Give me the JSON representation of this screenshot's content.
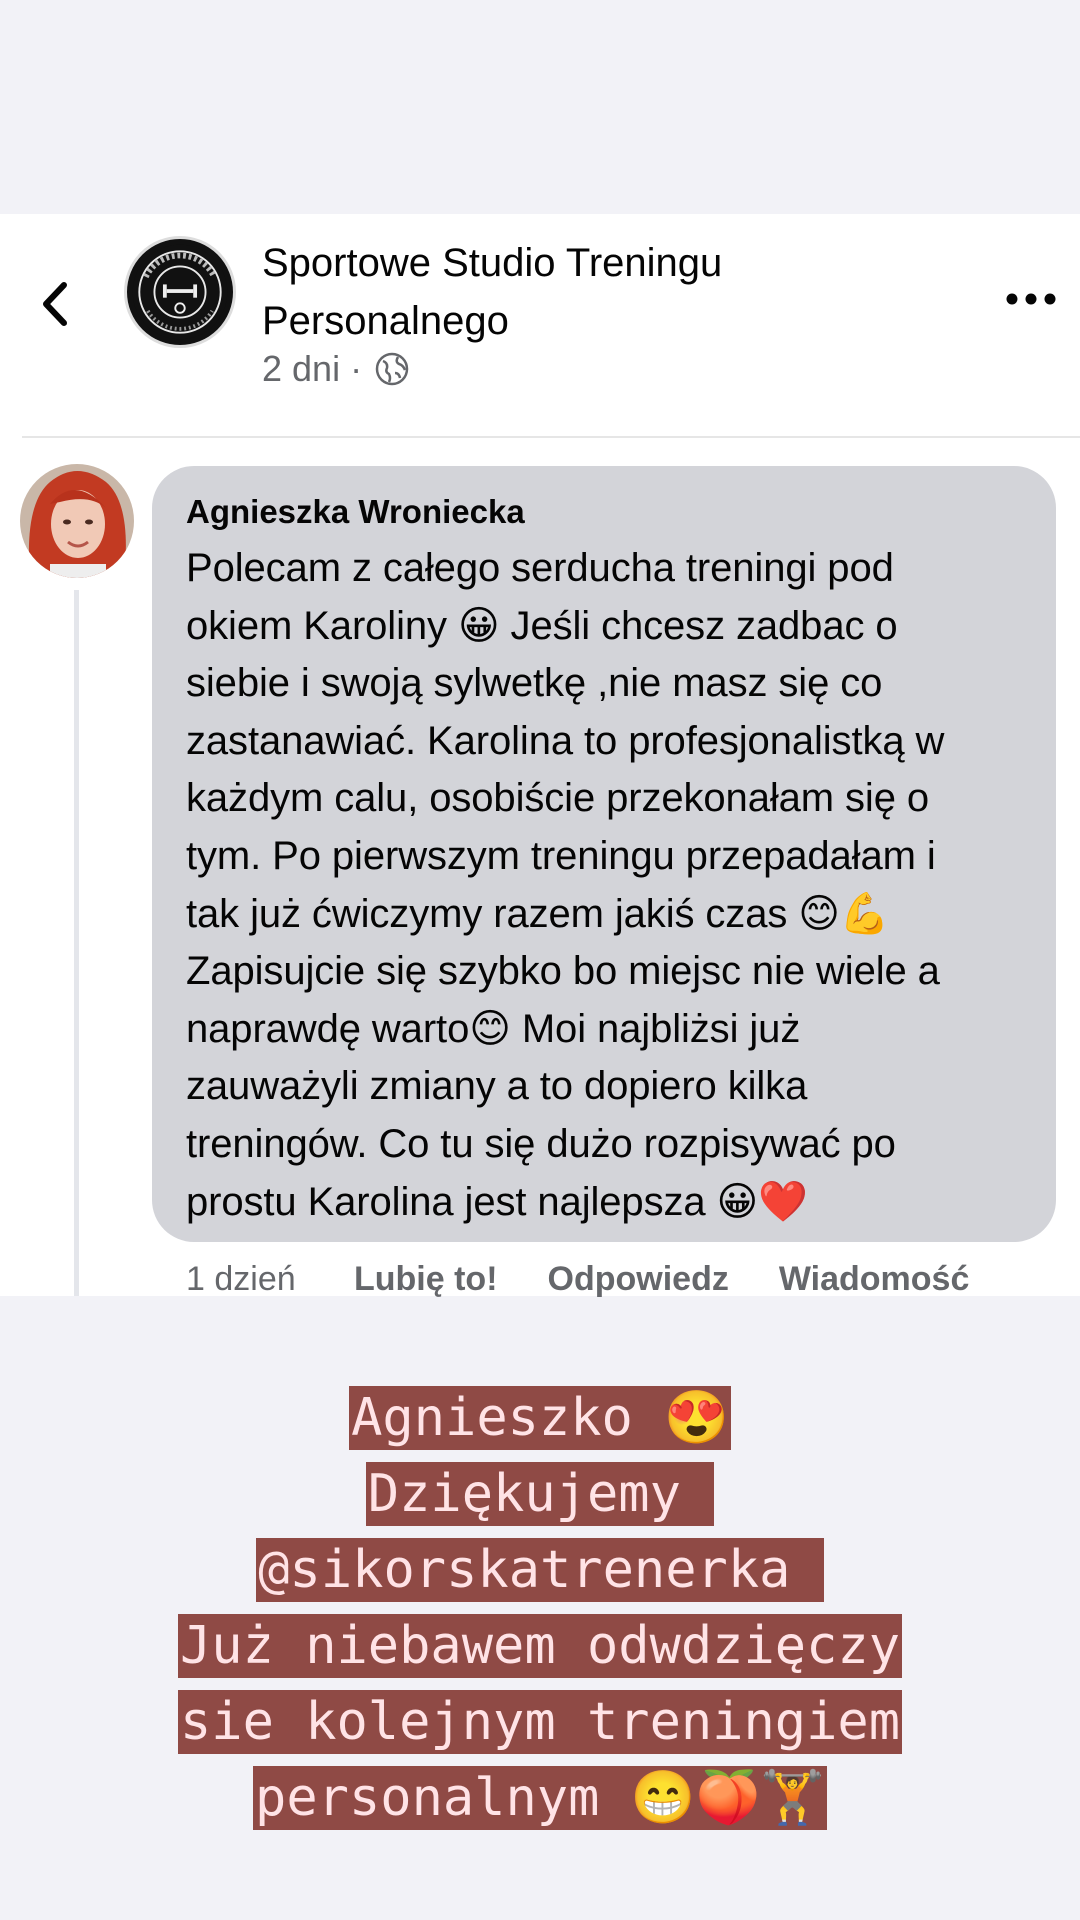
{
  "header": {
    "page_name": "Sportowe Studio Treningu Personalnego",
    "post_time": "2 dni",
    "separator": "·",
    "audience_icon": "globe-icon",
    "back_icon": "chevron-left-icon",
    "more_icon": "more-horizontal-icon"
  },
  "comment": {
    "author": "Agnieszka Wroniecka",
    "text": "Polecam z całego serducha treningi pod\nokiem Karoliny 😀 Jeśli chcesz zadbac o\nsiebie i swoją sylwetkę ,nie masz się co\nzastanawiać. Karolina to profesjonalistką w\nkażdym calu, osobiście przekonałam się o\ntym. Po pierwszym treningu przepadałam i\ntak już ćwiczymy razem jakiś czas 😊💪\nZapisujcie się szybko bo miejsc nie wiele a\nnaprawdę warto😊 Moi najbliżsi już\nzauważyli zmiany  a to dopiero kilka\ntreningów. Co tu się dużo rozpisywać po\nprostu Karolina jest najlepsza 😀❤️",
    "time": "1 dzień",
    "like_label": "Lubię to!",
    "reply_label": "Odpowiedz",
    "message_label": "Wiadomość"
  },
  "caption": {
    "lines": [
      "Agnieszko 😍",
      "Dziękujemy ",
      "@sikorskatrenerka ",
      "Już niebawem odwdzięczy",
      "sie kolejnym treningiem",
      "personalnym 😁🍑🏋️"
    ]
  },
  "colors": {
    "bubble": "#d3d4d9",
    "caption_highlight": "#8f4a45",
    "caption_text": "#ffe3e6",
    "meta_text": "#65676b"
  }
}
